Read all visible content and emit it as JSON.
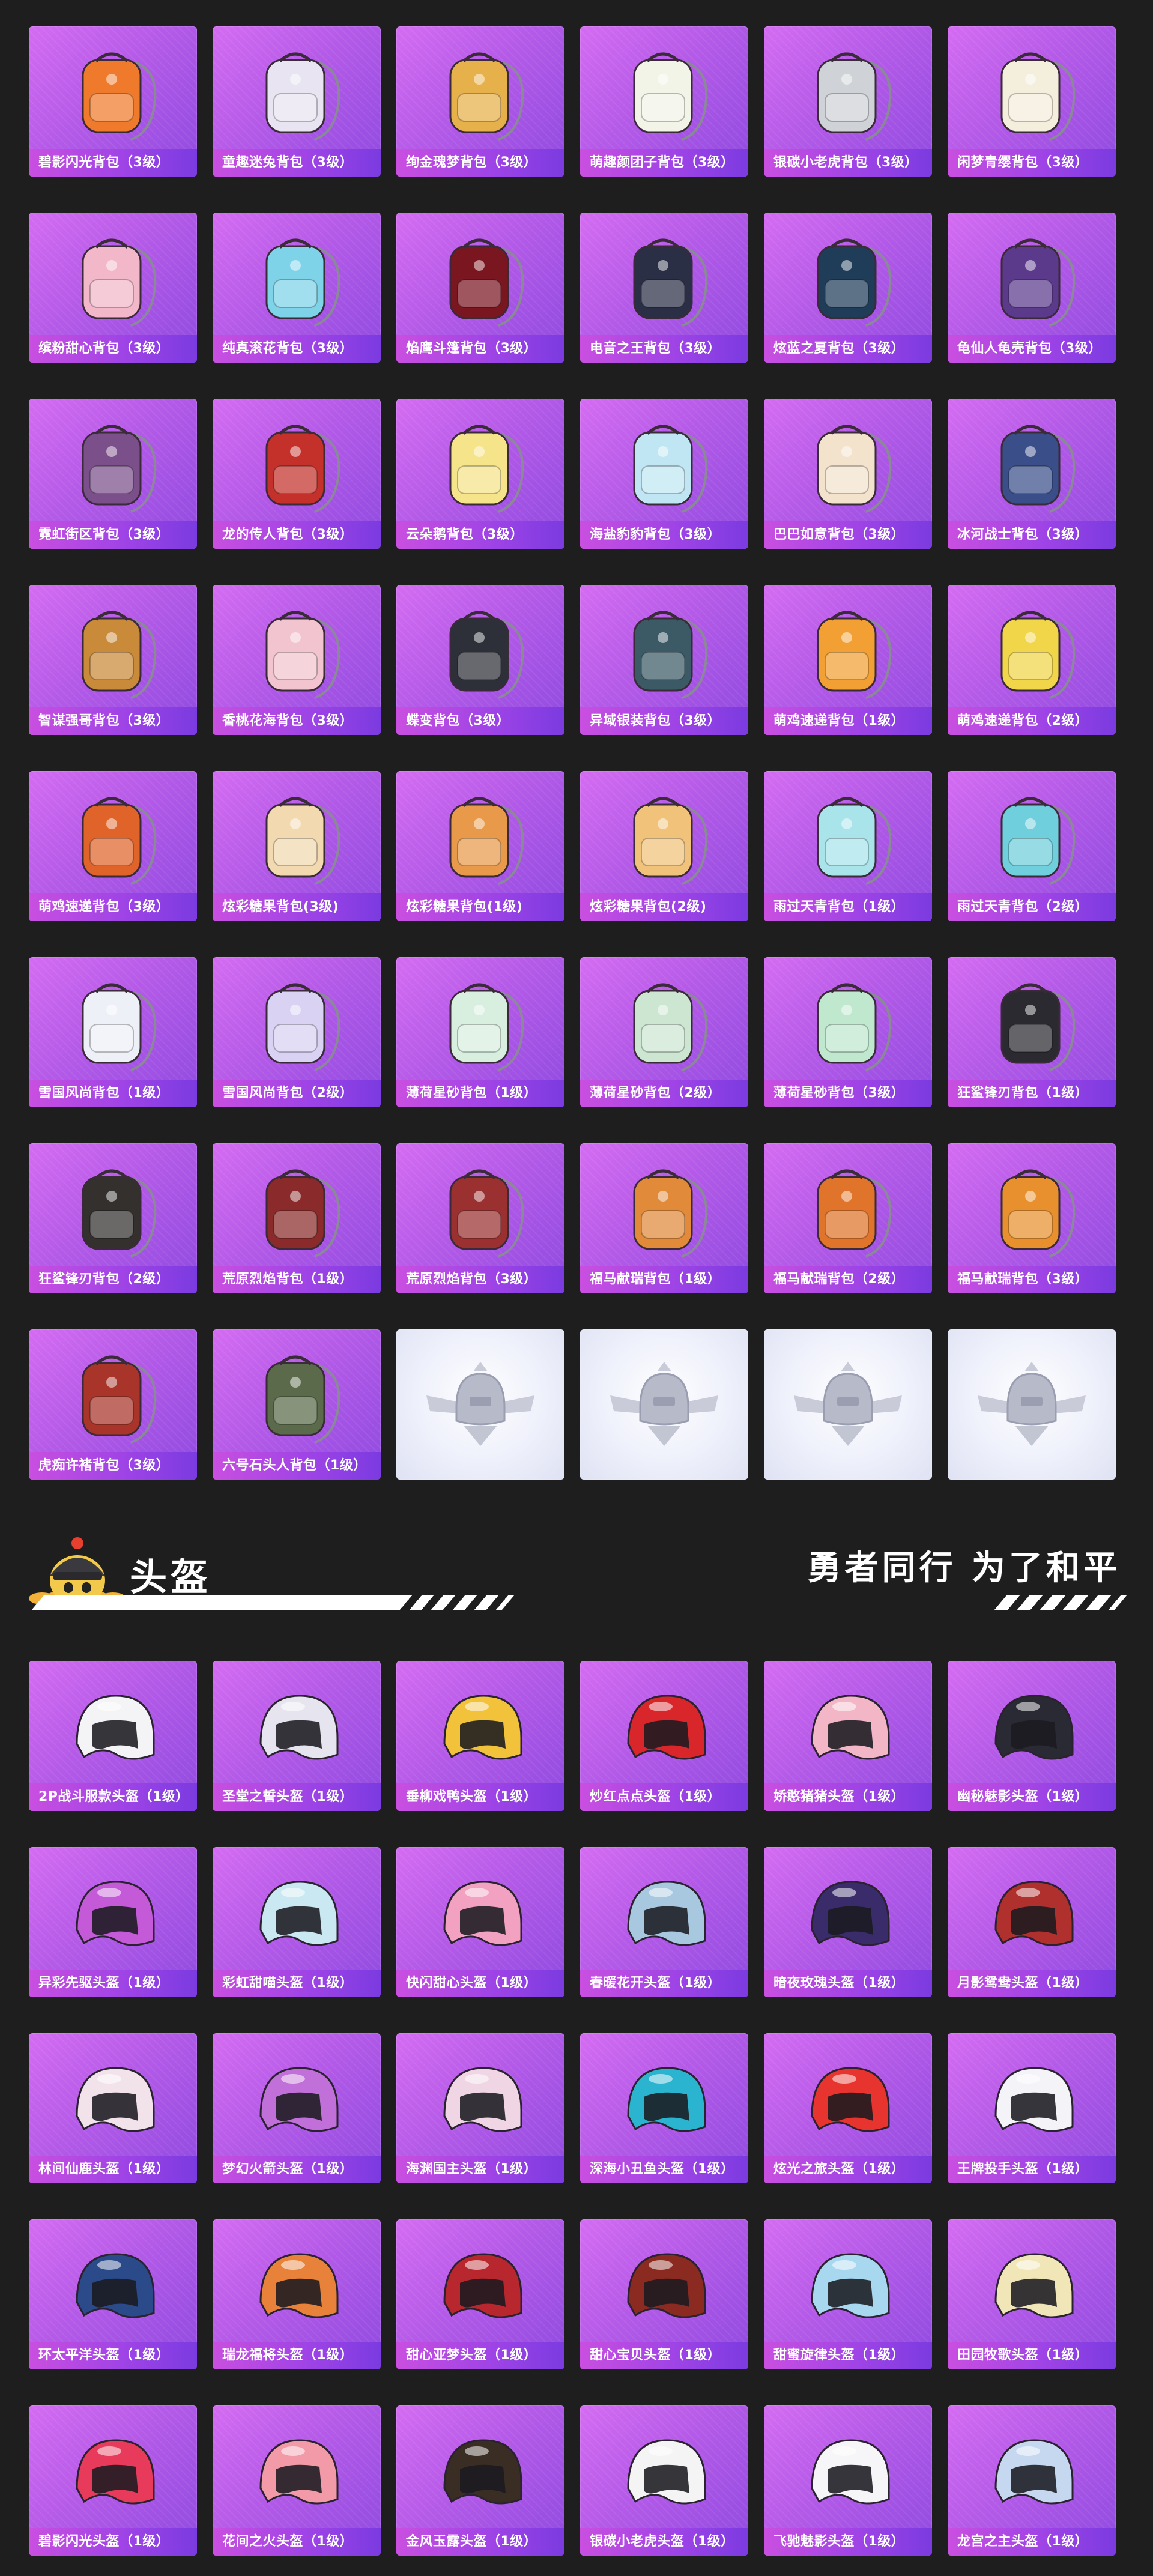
{
  "backpacks": {
    "items": [
      {
        "label": "碧影闪光背包（3级）",
        "color": "#f07a2b",
        "icon": "backpack-icon"
      },
      {
        "label": "童趣迷兔背包（3级）",
        "color": "#e8e4f2",
        "icon": "backpack-icon"
      },
      {
        "label": "绚金瑰梦背包（3级）",
        "color": "#e6b04a",
        "icon": "backpack-icon"
      },
      {
        "label": "萌趣颜团子背包（3级）",
        "color": "#f2f4e8",
        "icon": "backpack-icon"
      },
      {
        "label": "银碳小老虎背包（3级）",
        "color": "#cfd2d6",
        "icon": "backpack-icon"
      },
      {
        "label": "闲梦青缨背包（3级）",
        "color": "#f4eedc",
        "icon": "backpack-icon"
      },
      {
        "label": "缤粉甜心背包（3级）",
        "color": "#f2b7c9",
        "icon": "backpack-icon"
      },
      {
        "label": "纯真滚花背包（3级）",
        "color": "#7fd3e8",
        "icon": "backpack-icon"
      },
      {
        "label": "焰鹰斗篷背包（3级）",
        "color": "#7a1620",
        "icon": "backpack-icon"
      },
      {
        "label": "电音之王背包（3级）",
        "color": "#2a2f45",
        "icon": "backpack-icon"
      },
      {
        "label": "炫蓝之夏背包（3级）",
        "color": "#1f3c58",
        "icon": "backpack-icon"
      },
      {
        "label": "龟仙人龟壳背包（3级）",
        "color": "#5b3a8c",
        "icon": "backpack-icon"
      },
      {
        "label": "霓虹街区背包（3级）",
        "color": "#7a4f8a",
        "icon": "backpack-icon"
      },
      {
        "label": "龙的传人背包（3级）",
        "color": "#c4312b",
        "icon": "backpack-icon"
      },
      {
        "label": "云朵鹅背包（3级）",
        "color": "#f5e48a",
        "icon": "backpack-icon"
      },
      {
        "label": "海盐豹豹背包（3级）",
        "color": "#bfe6f2",
        "icon": "backpack-icon"
      },
      {
        "label": "巴巴如意背包（3级）",
        "color": "#f3e2cc",
        "icon": "backpack-icon"
      },
      {
        "label": "冰河战士背包（3级）",
        "color": "#3a4f8a",
        "icon": "backpack-icon"
      },
      {
        "label": "智谋强哥背包（3级）",
        "color": "#c98a3a",
        "icon": "backpack-icon"
      },
      {
        "label": "香桃花海背包（3级）",
        "color": "#f2c4cf",
        "icon": "backpack-icon"
      },
      {
        "label": "蝶变背包（3级）",
        "color": "#2d3038",
        "icon": "backpack-icon"
      },
      {
        "label": "异域银装背包（3级）",
        "color": "#3c5a66",
        "icon": "backpack-icon"
      },
      {
        "label": "萌鸡速递背包（1级）",
        "color": "#f2a033",
        "icon": "backpack-icon"
      },
      {
        "label": "萌鸡速递背包（2级）",
        "color": "#f2d64a",
        "icon": "backpack-icon"
      },
      {
        "label": "萌鸡速递背包（3级）",
        "color": "#e0642a",
        "icon": "backpack-icon"
      },
      {
        "label": "炫彩糖果背包(3级)",
        "color": "#f2d9b0",
        "icon": "backpack-icon"
      },
      {
        "label": "炫彩糖果背包(1级)",
        "color": "#e89a4a",
        "icon": "backpack-icon"
      },
      {
        "label": "炫彩糖果背包(2级)",
        "color": "#f0c27a",
        "icon": "backpack-icon"
      },
      {
        "label": "雨过天青背包（1级）",
        "color": "#a8e4ea",
        "icon": "backpack-icon"
      },
      {
        "label": "雨过天青背包（2级）",
        "color": "#6fcfdc",
        "icon": "backpack-icon"
      },
      {
        "label": "雪国风尚背包（1级）",
        "color": "#eef0f8",
        "icon": "backpack-icon"
      },
      {
        "label": "雪国风尚背包（2级）",
        "color": "#d9d2f2",
        "icon": "backpack-icon"
      },
      {
        "label": "薄荷星砂背包（1级）",
        "color": "#d8efe0",
        "icon": "backpack-icon"
      },
      {
        "label": "薄荷星砂背包（2级）",
        "color": "#cde6d2",
        "icon": "backpack-icon"
      },
      {
        "label": "薄荷星砂背包（3级）",
        "color": "#bfe8cf",
        "icon": "backpack-icon"
      },
      {
        "label": "狂鲨锋刃背包（1级）",
        "color": "#2a2a30",
        "icon": "backpack-icon"
      },
      {
        "label": "狂鲨锋刃背包（2级）",
        "color": "#33302e",
        "icon": "backpack-icon"
      },
      {
        "label": "荒原烈焰背包（1级）",
        "color": "#8a2a2a",
        "icon": "backpack-icon"
      },
      {
        "label": "荒原烈焰背包（3级）",
        "color": "#9a3030",
        "icon": "backpack-icon"
      },
      {
        "label": "福马献瑞背包（1级）",
        "color": "#e08a3a",
        "icon": "backpack-icon"
      },
      {
        "label": "福马献瑞背包（2级）",
        "color": "#e0742a",
        "icon": "backpack-icon"
      },
      {
        "label": "福马献瑞背包（3级）",
        "color": "#e8902e",
        "icon": "backpack-icon"
      },
      {
        "label": "虎痴许褚背包（3级）",
        "color": "#a8342a",
        "icon": "backpack-icon"
      },
      {
        "label": "六号石头人背包（1级）",
        "color": "#5a6a4a",
        "icon": "backpack-icon"
      }
    ],
    "empty_slots": [
      {
        "icon": "pubg-emblem-icon"
      },
      {
        "icon": "pubg-emblem-icon"
      },
      {
        "icon": "pubg-emblem-icon"
      },
      {
        "icon": "pubg-emblem-icon"
      }
    ]
  },
  "helmet_section": {
    "title": "头盔",
    "slogan": "勇者同行 为了和平",
    "mascot_icon": "chicken-mascot-icon"
  },
  "helmets": {
    "items": [
      {
        "label": "2P战斗服款头盔（1级）",
        "color": "#f4f4f6",
        "icon": "helmet-icon"
      },
      {
        "label": "圣堂之誓头盔（1级）",
        "color": "#e6e4ee",
        "icon": "helmet-icon"
      },
      {
        "label": "垂柳戏鸭头盔（1级）",
        "color": "#f2c23a",
        "icon": "helmet-icon"
      },
      {
        "label": "炒红点点头盔（1级）",
        "color": "#d8262a",
        "icon": "helmet-icon"
      },
      {
        "label": "娇憨猪猪头盔（1级）",
        "color": "#f2b6c6",
        "icon": "helmet-icon"
      },
      {
        "label": "幽秘魅影头盔（1级）",
        "color": "#2a2a34",
        "icon": "helmet-icon"
      },
      {
        "label": "异彩先驱头盔（1级）",
        "color": "#c45ad8",
        "icon": "helmet-icon"
      },
      {
        "label": "彩虹甜喵头盔（1级）",
        "color": "#c9e8f2",
        "icon": "helmet-icon"
      },
      {
        "label": "快闪甜心头盔（1级）",
        "color": "#f2a2c0",
        "icon": "helmet-icon"
      },
      {
        "label": "春暖花开头盔（1级）",
        "color": "#a8c8e0",
        "icon": "helmet-icon"
      },
      {
        "label": "暗夜玫瑰头盔（1级）",
        "color": "#3a2c6a",
        "icon": "helmet-icon"
      },
      {
        "label": "月影鸳鸯头盔（1级）",
        "color": "#b0302e",
        "icon": "helmet-icon"
      },
      {
        "label": "林间仙鹿头盔（1级）",
        "color": "#f2e2ea",
        "icon": "helmet-icon"
      },
      {
        "label": "梦幻火箭头盔（1级）",
        "color": "#c070d8",
        "icon": "helmet-icon"
      },
      {
        "label": "海渊国主头盔（1级）",
        "color": "#f0d6e4",
        "icon": "helmet-icon"
      },
      {
        "label": "深海小丑鱼头盔（1级）",
        "color": "#2ab4d0",
        "icon": "helmet-icon"
      },
      {
        "label": "炫光之旅头盔（1级）",
        "color": "#e8342e",
        "icon": "helmet-icon"
      },
      {
        "label": "王牌投手头盔（1级）",
        "color": "#f4f4f8",
        "icon": "helmet-icon"
      },
      {
        "label": "环太平洋头盔（1级）",
        "color": "#2a4a8a",
        "icon": "helmet-icon"
      },
      {
        "label": "瑞龙福将头盔（1级）",
        "color": "#e8823a",
        "icon": "helmet-icon"
      },
      {
        "label": "甜心亚梦头盔（1级）",
        "color": "#b8262e",
        "icon": "helmet-icon"
      },
      {
        "label": "甜心宝贝头盔（1级）",
        "color": "#8a2a20",
        "icon": "helmet-icon"
      },
      {
        "label": "甜蜜旋律头盔（1级）",
        "color": "#a8d8f0",
        "icon": "helmet-icon"
      },
      {
        "label": "田园牧歌头盔（1级）",
        "color": "#f0e6b8",
        "icon": "helmet-icon"
      },
      {
        "label": "碧影闪光头盔（1级）",
        "color": "#e83a5a",
        "icon": "helmet-icon"
      },
      {
        "label": "花间之火头盔（1级）",
        "color": "#f29aa8",
        "icon": "helmet-icon"
      },
      {
        "label": "金风玉露头盔（1级）",
        "color": "#3a2e24",
        "icon": "helmet-icon"
      },
      {
        "label": "银碳小老虎头盔（1级）",
        "color": "#f4f4f4",
        "icon": "helmet-icon"
      },
      {
        "label": "飞驰魅影头盔（1级）",
        "color": "#f6f6f8",
        "icon": "helmet-icon"
      },
      {
        "label": "龙宫之主头盔（1级）",
        "color": "#c6d8f0",
        "icon": "helmet-icon"
      }
    ]
  }
}
